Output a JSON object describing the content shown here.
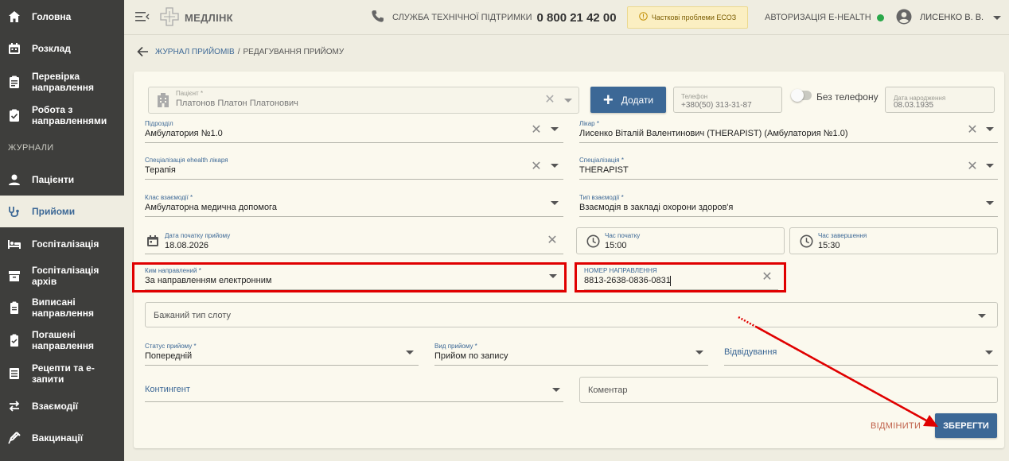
{
  "sidebar": {
    "items": [
      {
        "label": "Головна",
        "icon": "home-icon"
      },
      {
        "label": "Розклад",
        "icon": "calendar-icon"
      },
      {
        "label": "Перевірка направлення",
        "icon": "clipboard-check-icon"
      },
      {
        "label": "Робота з направленнями",
        "icon": "clipboard-list-icon"
      },
      {
        "label": "Пацієнти",
        "icon": "person-icon"
      },
      {
        "label": "Прийоми",
        "icon": "stethoscope-icon"
      },
      {
        "label": "Госпіталізація",
        "icon": "bed-icon"
      },
      {
        "label": "Госпіталізація архів",
        "icon": "archive-icon"
      },
      {
        "label": "Виписані направлення",
        "icon": "document-icon"
      },
      {
        "label": "Погашені направлення",
        "icon": "document-check-icon"
      },
      {
        "label": "Рецепти та е-запити",
        "icon": "list-icon"
      },
      {
        "label": "Взаємодії",
        "icon": "swap-icon"
      },
      {
        "label": "Вакцинації",
        "icon": "syringe-icon"
      }
    ],
    "section_journals": "ЖУРНАЛИ",
    "active_index": 5
  },
  "topbar": {
    "logo_text": "МЕДЛІНК",
    "support_label": "СЛУЖБА ТЕХНІЧНОЇ ПІДТРИМКИ",
    "support_phone": "0 800 21 42 00",
    "warning_text": "Часткові проблеми ЕСОЗ",
    "ehealth_label": "АВТОРИЗАЦІЯ E-HEALTH",
    "ehealth_status_color": "#2aa84a",
    "user_name": "ЛИСЕНКО В. В."
  },
  "breadcrumb": {
    "parent": "ЖУРНАЛ ПРИЙОМІВ",
    "separator": "/",
    "current": "РЕДАГУВАННЯ ПРИЙОМУ"
  },
  "form": {
    "patient": {
      "label": "Пацієнт *",
      "value": "Платонов Платон Платонович"
    },
    "add_button": "Додати",
    "phone": {
      "label": "Телефон",
      "value": "+380(50) 313-31-87"
    },
    "no_phone_label": "Без телефону",
    "birth_date": {
      "label": "Дата народження",
      "value": "08.03.1935"
    },
    "department": {
      "label": "Підрозділ",
      "value": "Амбулатория №1.0"
    },
    "doctor": {
      "label": "Лікар *",
      "value": "Лисенко Віталій Валентинович (THERAPIST) (Амбулатория №1.0)"
    },
    "ehealth_specialization": {
      "label": "Спеціалізація ehealth лікаря",
      "value": "Терапія"
    },
    "specialization": {
      "label": "Спеціалізація *",
      "value": "THERAPIST"
    },
    "interaction_class": {
      "label": "Клас взаємодії *",
      "value": "Амбулаторна медична допомога"
    },
    "interaction_type": {
      "label": "Тип взаємодії *",
      "value": "Взаємодія в закладі охорони здоров'я"
    },
    "start_date": {
      "label": "Дата початку прийому",
      "value": "18.08.2026"
    },
    "start_time": {
      "label": "Час початку",
      "value": "15:00"
    },
    "end_time": {
      "label": "Час завершення",
      "value": "15:30"
    },
    "referred_by": {
      "label": "Ким направлений *",
      "value": "За направленням електронним"
    },
    "referral_number": {
      "label": "НОМЕР НАПРАВЛЕННЯ",
      "value": "8813-2638-0836-0831"
    },
    "slot_type": {
      "placeholder": "Бажаний тип слоту"
    },
    "status": {
      "label": "Статус прийому *",
      "value": "Попередній"
    },
    "visit_kind": {
      "label": "Вид прийому *",
      "value": "Прийом по запису"
    },
    "attendance": {
      "placeholder": "Відвідування"
    },
    "contingent": {
      "placeholder": "Контингент"
    },
    "comment": {
      "placeholder": "Коментар"
    },
    "cancel_button": "ВІДМІНИТИ",
    "save_button": "ЗБЕРЕГТИ"
  },
  "colors": {
    "accent": "#3c6896",
    "highlight": "#e00000",
    "cancel": "#c0614a",
    "sidebar": "#3e3e3c"
  }
}
